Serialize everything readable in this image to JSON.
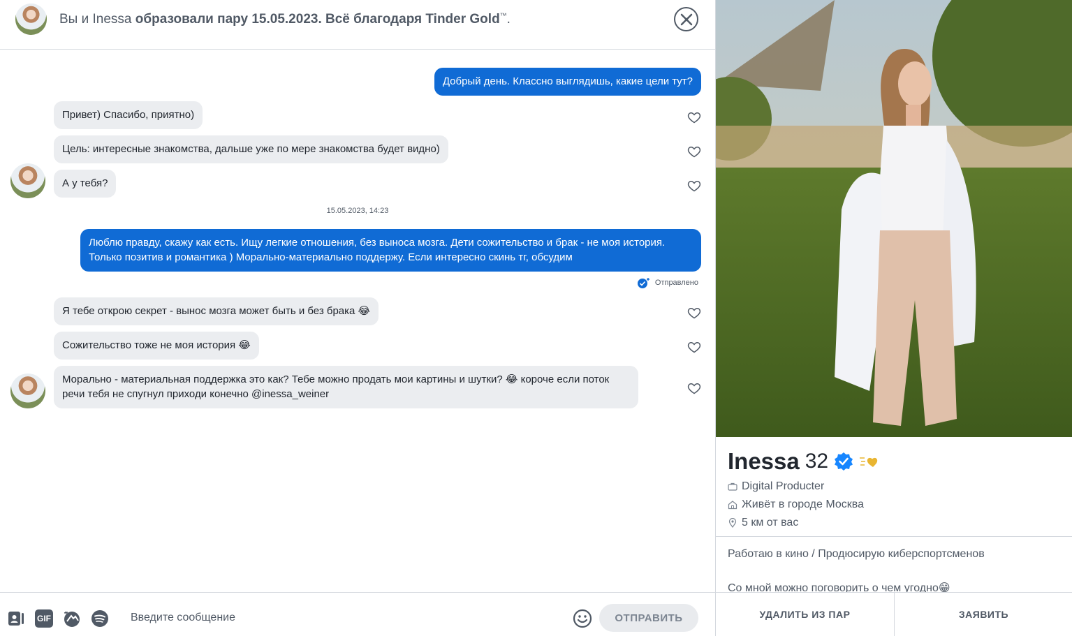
{
  "header": {
    "match_prefix": "Вы и Inessa",
    "match_bold": "образовали пару 15.05.2023. Всё благодаря Tinder Gold",
    "tm": "™",
    "suffix": "."
  },
  "messages": [
    {
      "dir": "out",
      "text": "Добрый день. Классно выглядишь, какие цели тут?"
    },
    {
      "dir": "in",
      "text": "Привет) Спасибо, приятно)"
    },
    {
      "dir": "in",
      "text": "Цель: интересные знакомства, дальше уже по мере знакомства будет видно)"
    },
    {
      "dir": "in",
      "text": "А у тебя?"
    },
    {
      "dir": "out",
      "text": "Люблю правду, скажу как есть. Ищу легкие отношения, без выноса мозга. Дети сожительство и брак - не моя история. Только позитив и романтика ) Морально-материально поддержу. Если интересно скинь тг, обсудим"
    },
    {
      "dir": "in",
      "text": "Я тебе открою секрет - вынос мозга может быть и без брака 😂"
    },
    {
      "dir": "in",
      "text": "Сожительство тоже не моя история 😂"
    },
    {
      "dir": "in",
      "text": "Морально - материальная поддержка это как? Тебе можно продать мои картины и шутки? 😂 короче если поток речи тебя не спугнул приходи конечно      @inessa_weiner"
    }
  ],
  "timestamp": "15.05.2023, 14:23",
  "status": "Отправлено",
  "composer": {
    "placeholder": "Введите сообщение",
    "send_label": "ОТПРАВИТЬ",
    "gif_label": "GIF"
  },
  "profile": {
    "name": "Inessa",
    "age": "32",
    "job": "Digital Producter",
    "city": "Живёт в городе Москва",
    "distance": "5 км от вас",
    "bio_line1": "Работаю в кино / Продюсирую киберспортсменов",
    "bio_line2": "Со мной можно поговорить о чем угодно😁",
    "remove_label": "УДАЛИТЬ ИЗ ПАР",
    "report_label": "ЗАЯВИТЬ"
  },
  "colors": {
    "outgoing": "#106bd5",
    "incoming": "#ebedf0",
    "verified": "#1786ff",
    "gold": "#e9b531"
  }
}
